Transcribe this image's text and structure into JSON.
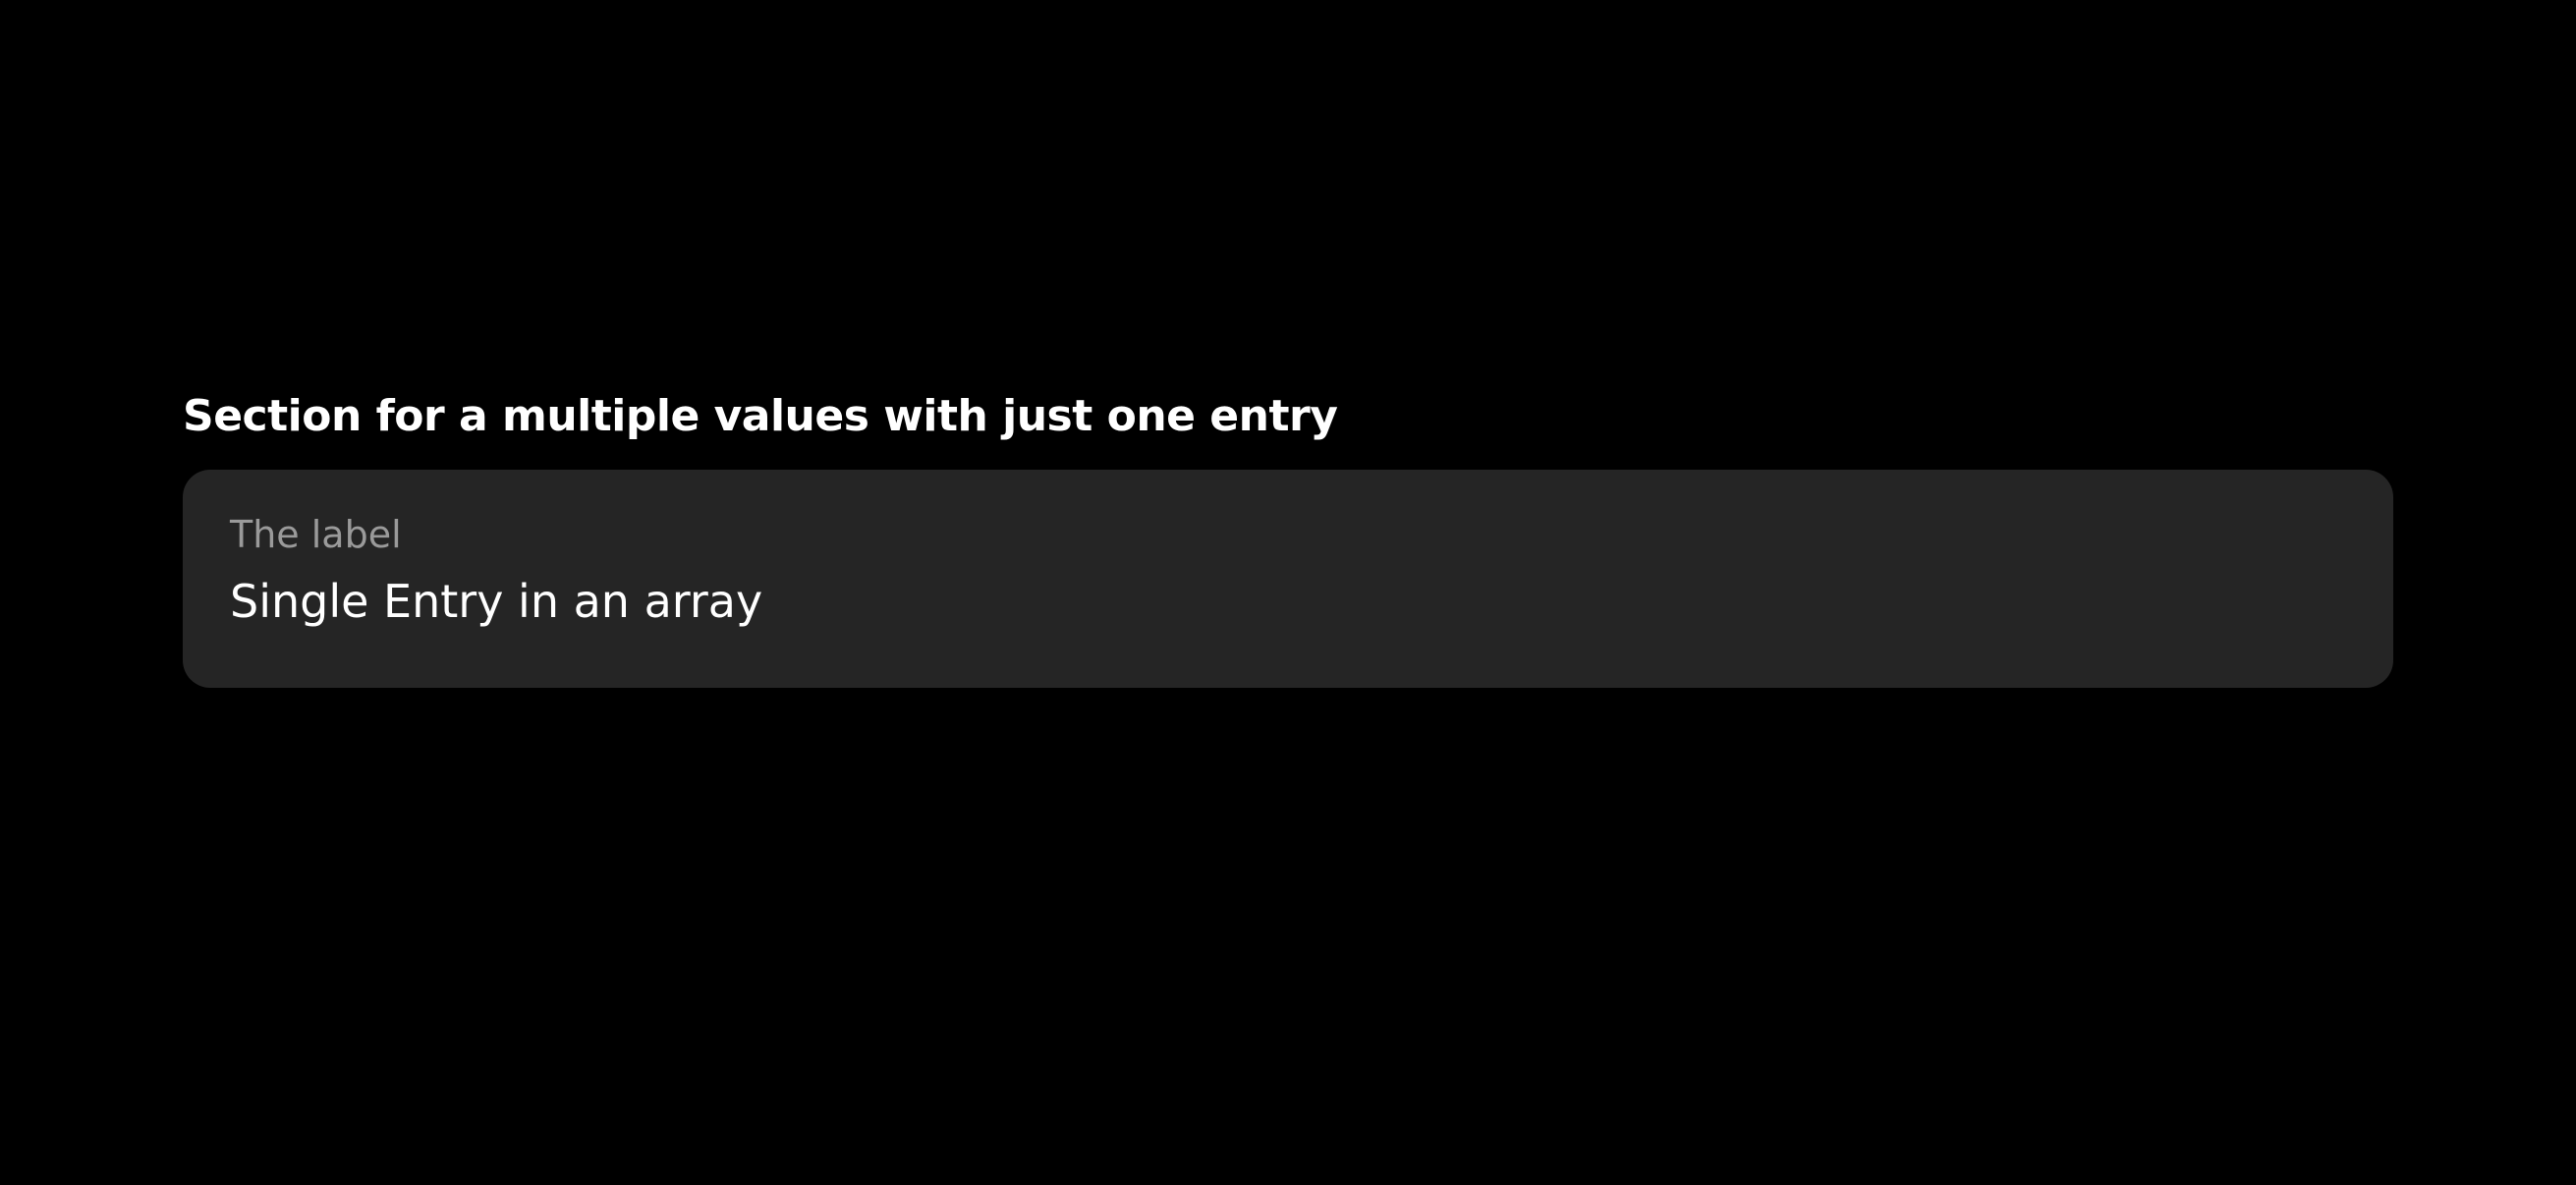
{
  "section": {
    "header": "Section for a multiple values with just one entry",
    "rows": [
      {
        "label": "The label",
        "value": "Single Entry in an array"
      }
    ]
  },
  "colors": {
    "background": "#000000",
    "card": "#252525",
    "label_text": "#9a9a9a",
    "value_text": "#ffffff"
  }
}
